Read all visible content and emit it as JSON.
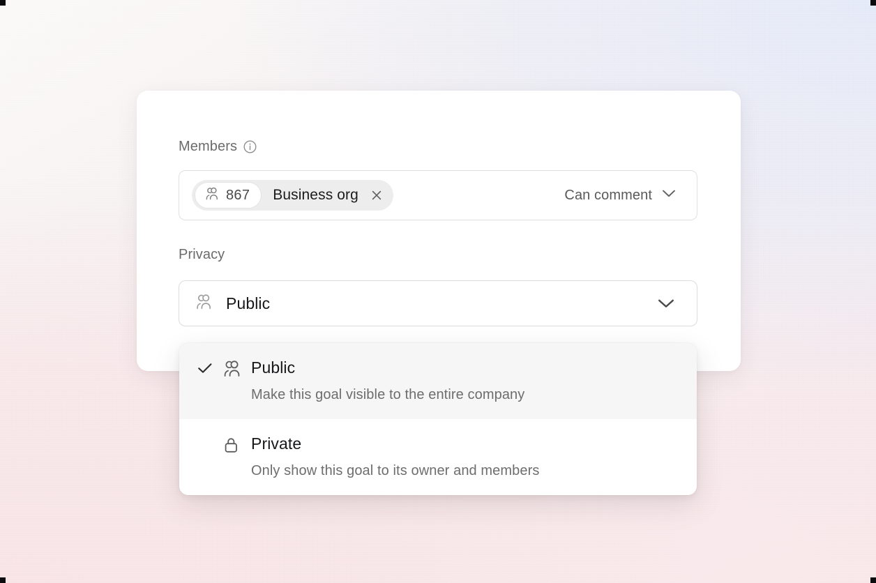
{
  "theme": {
    "card_bg": "#ffffff",
    "chip_bg": "#ededed",
    "menu_highlight": "#f7f6f6",
    "text_primary": "#17181a",
    "text_secondary": "#6b6b6b",
    "border": "#e2e1e0",
    "backdrop_pink": "#f8e4e6",
    "backdrop_blue": "#e5eaf8"
  },
  "members": {
    "label": "Members",
    "info_icon": "info-circle-icon",
    "chip": {
      "count_icon": "users-icon",
      "count": "867",
      "name": "Business org",
      "remove_icon": "close-icon"
    },
    "permission": {
      "value": "Can comment",
      "chevron_icon": "chevron-down-icon"
    }
  },
  "privacy": {
    "label": "Privacy",
    "select": {
      "icon": "users-icon",
      "value": "Public",
      "chevron_icon": "chevron-down-icon"
    },
    "menu": {
      "options": [
        {
          "title": "Public",
          "description": "Make this goal visible to the entire company",
          "icon": "users-icon",
          "check_icon": "check-icon",
          "selected": true
        },
        {
          "title": "Private",
          "description": "Only show this goal to its owner and members",
          "icon": "lock-icon",
          "check_icon": "check-icon",
          "selected": false
        }
      ]
    }
  }
}
